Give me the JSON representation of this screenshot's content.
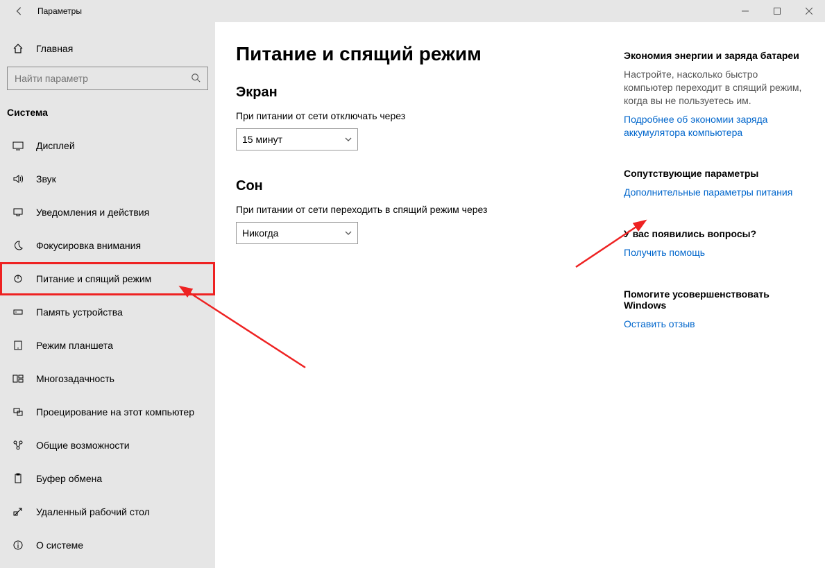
{
  "window": {
    "title": "Параметры"
  },
  "sidebar": {
    "home": "Главная",
    "search_placeholder": "Найти параметр",
    "section": "Система",
    "items": [
      {
        "label": "Дисплей"
      },
      {
        "label": "Звук"
      },
      {
        "label": "Уведомления и действия"
      },
      {
        "label": "Фокусировка внимания"
      },
      {
        "label": "Питание и спящий режим"
      },
      {
        "label": "Память устройства"
      },
      {
        "label": "Режим планшета"
      },
      {
        "label": "Многозадачность"
      },
      {
        "label": "Проецирование на этот компьютер"
      },
      {
        "label": "Общие возможности"
      },
      {
        "label": "Буфер обмена"
      },
      {
        "label": "Удаленный рабочий стол"
      },
      {
        "label": "О системе"
      }
    ]
  },
  "main": {
    "title": "Питание и спящий режим",
    "screen": {
      "heading": "Экран",
      "label": "При питании от сети отключать через",
      "value": "15 минут"
    },
    "sleep": {
      "heading": "Сон",
      "label": "При питании от сети переходить в спящий режим через",
      "value": "Никогда"
    }
  },
  "aside": {
    "energy": {
      "heading": "Экономия энергии и заряда батареи",
      "text": "Настройте, насколько быстро компьютер переходит в спящий режим, когда вы не пользуетесь им.",
      "link": "Подробнее об экономии заряда аккумулятора компьютера"
    },
    "related": {
      "heading": "Сопутствующие параметры",
      "link": "Дополнительные параметры питания"
    },
    "question": {
      "heading": "У вас появились вопросы?",
      "link": "Получить помощь"
    },
    "feedback": {
      "heading": "Помогите усовершенствовать Windows",
      "link": "Оставить отзыв"
    }
  }
}
